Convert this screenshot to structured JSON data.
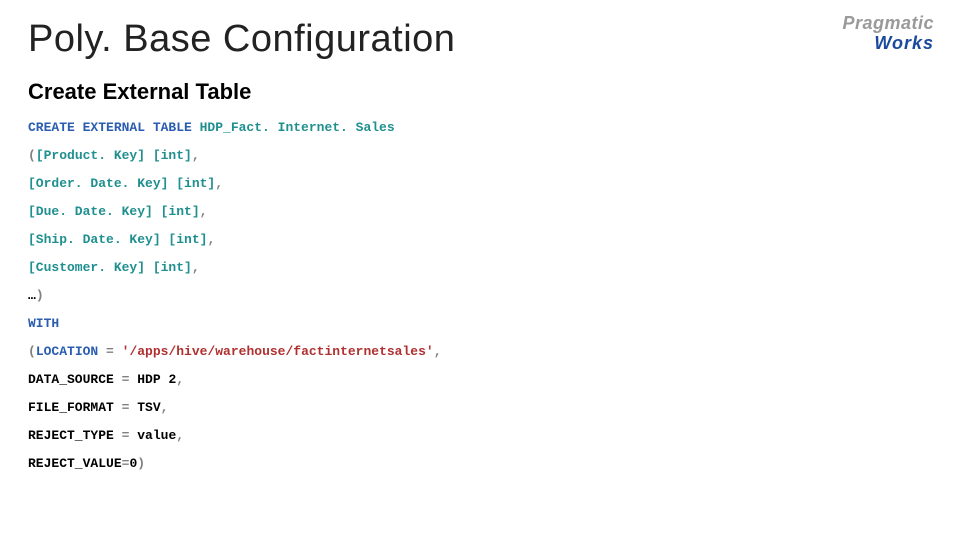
{
  "header": {
    "title": "Poly. Base Configuration",
    "subtitle": "Create External Table"
  },
  "logo": {
    "line1": "Pragmatic",
    "line2": "Works"
  },
  "code": {
    "l1_kw": "CREATE EXTERNAL TABLE",
    "l1_rest": " HDP_Fact. Internet. Sales",
    "l2_paren": "(",
    "l2_rest": "[Product. Key] [int]",
    "l3": "[Order. Date. Key] [int]",
    "l4": "[Due. Date. Key] [int]",
    "l5": "[Ship. Date. Key] [int]",
    "l6": "[Customer. Key] [int]",
    "l7_pre": "…",
    "l7_paren": ")",
    "l8": "WITH",
    "l9_paren": "(",
    "l9_key": "LOCATION",
    "l9_eq": " = ",
    "l9_val": "'/apps/hive/warehouse/factinternetsales'",
    "l10_key": "DATA_SOURCE",
    "l10_eq": " = ",
    "l10_val": "HDP 2",
    "l11_key": "FILE_FORMAT",
    "l11_eq": " = ",
    "l11_val": "TSV",
    "l12_key": "REJECT_TYPE",
    "l12_eq": " = ",
    "l12_val": "value",
    "l13_key": "REJECT_VALUE",
    "l13_eq": "=",
    "l13_val": "0",
    "l13_paren": ")",
    "comma": ","
  }
}
